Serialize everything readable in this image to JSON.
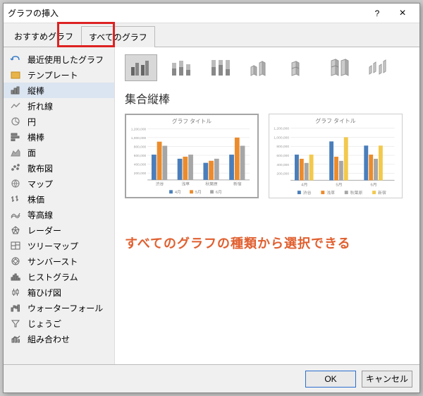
{
  "dialog": {
    "title": "グラフの挿入",
    "help_label": "?",
    "close_label": "×"
  },
  "tabs": {
    "recommended": "おすすめグラフ",
    "all": "すべてのグラフ"
  },
  "categories": [
    {
      "id": "recent",
      "label": "最近使用したグラフ"
    },
    {
      "id": "template",
      "label": "テンプレート"
    },
    {
      "id": "column",
      "label": "縦棒"
    },
    {
      "id": "line",
      "label": "折れ線"
    },
    {
      "id": "pie",
      "label": "円"
    },
    {
      "id": "bar",
      "label": "横棒"
    },
    {
      "id": "area",
      "label": "面"
    },
    {
      "id": "scatter",
      "label": "散布図"
    },
    {
      "id": "map",
      "label": "マップ"
    },
    {
      "id": "stock",
      "label": "株価"
    },
    {
      "id": "surface",
      "label": "等高線"
    },
    {
      "id": "radar",
      "label": "レーダー"
    },
    {
      "id": "treemap",
      "label": "ツリーマップ"
    },
    {
      "id": "sunburst",
      "label": "サンバースト"
    },
    {
      "id": "histogram",
      "label": "ヒストグラム"
    },
    {
      "id": "boxwhisker",
      "label": "箱ひげ図"
    },
    {
      "id": "waterfall",
      "label": "ウォーターフォール"
    },
    {
      "id": "funnel",
      "label": "じょうご"
    },
    {
      "id": "combo",
      "label": "組み合わせ"
    }
  ],
  "selected_category": "column",
  "subtype_title": "集合縦棒",
  "annotation": "すべてのグラフの種類から選択できる",
  "buttons": {
    "ok": "OK",
    "cancel": "キャンセル"
  },
  "preview_title": "グラフ タイトル",
  "preview1": {
    "xlabels": [
      "渋谷",
      "浅草",
      "秋葉原",
      "新宿"
    ],
    "legend": [
      "4月",
      "5月",
      "6月"
    ]
  },
  "preview2": {
    "xlabels": [
      "4月",
      "5月",
      "6月"
    ],
    "legend": [
      "渋谷",
      "浅草",
      "秋葉原",
      "新宿"
    ]
  },
  "chart_data": [
    {
      "type": "bar",
      "title": "グラフ タイトル",
      "categories": [
        "渋谷",
        "浅草",
        "秋葉原",
        "新宿"
      ],
      "series": [
        {
          "name": "4月",
          "values": [
            600000,
            500000,
            400000,
            600000
          ]
        },
        {
          "name": "5月",
          "values": [
            900000,
            550000,
            450000,
            1000000
          ]
        },
        {
          "name": "6月",
          "values": [
            800000,
            600000,
            500000,
            800000
          ]
        }
      ],
      "ylim": [
        0,
        1200000
      ],
      "y_ticks": [
        200000,
        400000,
        600000,
        800000,
        1000000,
        1200000
      ],
      "xlabel": "",
      "ylabel": ""
    },
    {
      "type": "bar",
      "title": "グラフ タイトル",
      "categories": [
        "4月",
        "5月",
        "6月"
      ],
      "series": [
        {
          "name": "渋谷",
          "values": [
            600000,
            900000,
            800000
          ]
        },
        {
          "name": "浅草",
          "values": [
            500000,
            550000,
            600000
          ]
        },
        {
          "name": "秋葉原",
          "values": [
            400000,
            450000,
            500000
          ]
        },
        {
          "name": "新宿",
          "values": [
            600000,
            1000000,
            800000
          ]
        }
      ],
      "ylim": [
        0,
        1200000
      ],
      "y_ticks": [
        200000,
        400000,
        600000,
        800000,
        1000000,
        1200000
      ],
      "xlabel": "",
      "ylabel": ""
    }
  ]
}
